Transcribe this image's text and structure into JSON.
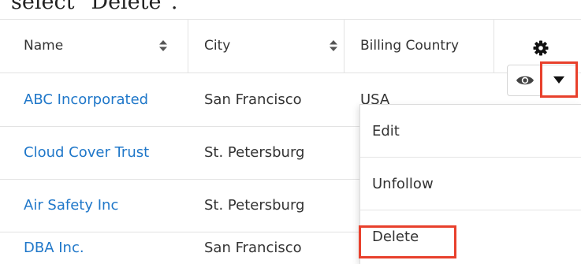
{
  "caption": {
    "text": "select \"Delete\"."
  },
  "table": {
    "columns": [
      {
        "label": "Name",
        "sortable": true
      },
      {
        "label": "City",
        "sortable": true
      },
      {
        "label": "Billing Country",
        "sortable": false
      }
    ],
    "settings_icon": "gear-icon",
    "rows": [
      {
        "name": "ABC Incorporated",
        "city": "San Francisco",
        "country": "USA"
      },
      {
        "name": "Cloud Cover Trust",
        "city": "St. Petersburg",
        "country": ""
      },
      {
        "name": "Air Safety Inc",
        "city": "St. Petersburg",
        "country": ""
      },
      {
        "name": "DBA Inc.",
        "city": "San Francisco",
        "country": ""
      }
    ],
    "row_actions": {
      "preview_icon": "eye-icon",
      "menu_icon": "caret-down-icon"
    }
  },
  "dropdown": {
    "items": [
      {
        "label": "Edit"
      },
      {
        "label": "Unfollow"
      },
      {
        "label": "Delete",
        "highlighted": true
      }
    ]
  },
  "colors": {
    "link": "#1f77c9",
    "highlight": "#e8402c",
    "text": "#333333",
    "border": "#e3e3e3"
  }
}
